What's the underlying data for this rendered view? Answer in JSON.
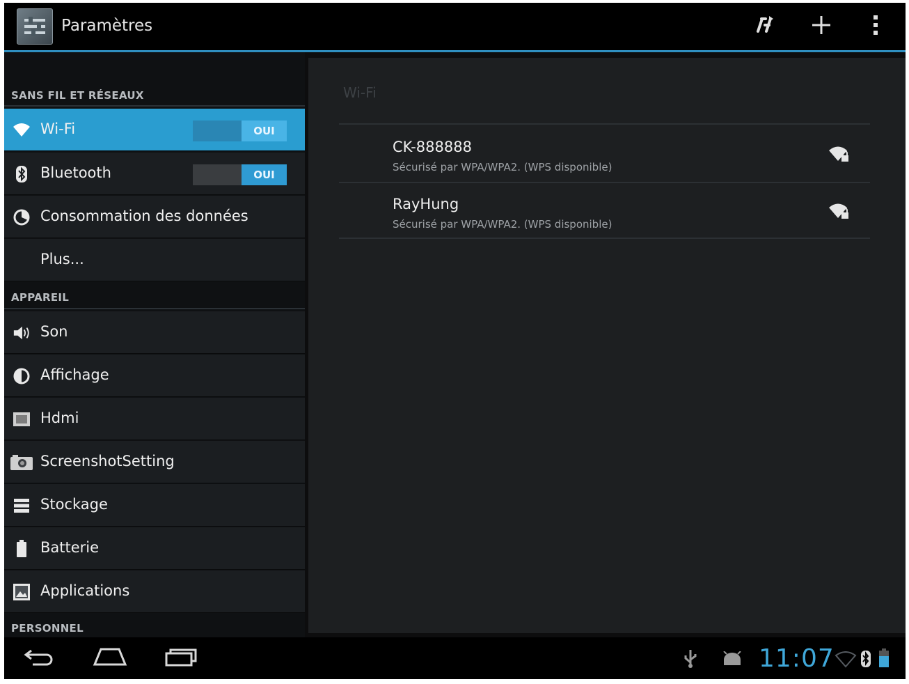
{
  "action_bar": {
    "title": "Paramètres",
    "icons": [
      "settings-app-icon",
      "wps-push-icon",
      "add-network-icon",
      "overflow-menu-icon"
    ]
  },
  "sidebar": {
    "sections": [
      {
        "header": "SANS FIL ET RÉSEAUX",
        "items": [
          {
            "label": "Wi-Fi",
            "icon": "wifi-icon",
            "toggle": "OUI",
            "active": true
          },
          {
            "label": "Bluetooth",
            "icon": "bluetooth-icon",
            "toggle": "OUI"
          },
          {
            "label": "Consommation des données",
            "icon": "data-usage-icon"
          },
          {
            "label": "Plus..."
          }
        ]
      },
      {
        "header": "APPAREIL",
        "items": [
          {
            "label": "Son",
            "icon": "speaker-icon"
          },
          {
            "label": "Affichage",
            "icon": "display-icon"
          },
          {
            "label": "Hdmi",
            "icon": "hdmi-icon"
          },
          {
            "label": "ScreenshotSetting",
            "icon": "camera-icon"
          },
          {
            "label": "Stockage",
            "icon": "storage-icon"
          },
          {
            "label": "Batterie",
            "icon": "battery-icon"
          },
          {
            "label": "Applications",
            "icon": "applications-icon"
          }
        ]
      },
      {
        "header": "PERSONNEL",
        "items": []
      }
    ]
  },
  "wifi_panel": {
    "title": "Wi-Fi",
    "networks": [
      {
        "ssid": "CK-888888",
        "status": "Sécurisé par WPA/WPA2. (WPS disponible)",
        "icon": "wifi-locked-icon"
      },
      {
        "ssid": "RayHung",
        "status": "Sécurisé par WPA/WPA2. (WPS disponible)",
        "icon": "wifi-locked-icon"
      }
    ]
  },
  "system_bar": {
    "time": "11:07",
    "nav": [
      "back-icon",
      "home-icon",
      "recent-apps-icon"
    ],
    "status_icons": [
      "usb-icon",
      "android-debug-icon",
      "wifi-status-icon",
      "bluetooth-status-icon",
      "battery-status-icon"
    ]
  },
  "colors": {
    "accent": "#2a9dd0",
    "clock": "#3fa7d9",
    "action_bar_underline": "#2f8fc0"
  }
}
